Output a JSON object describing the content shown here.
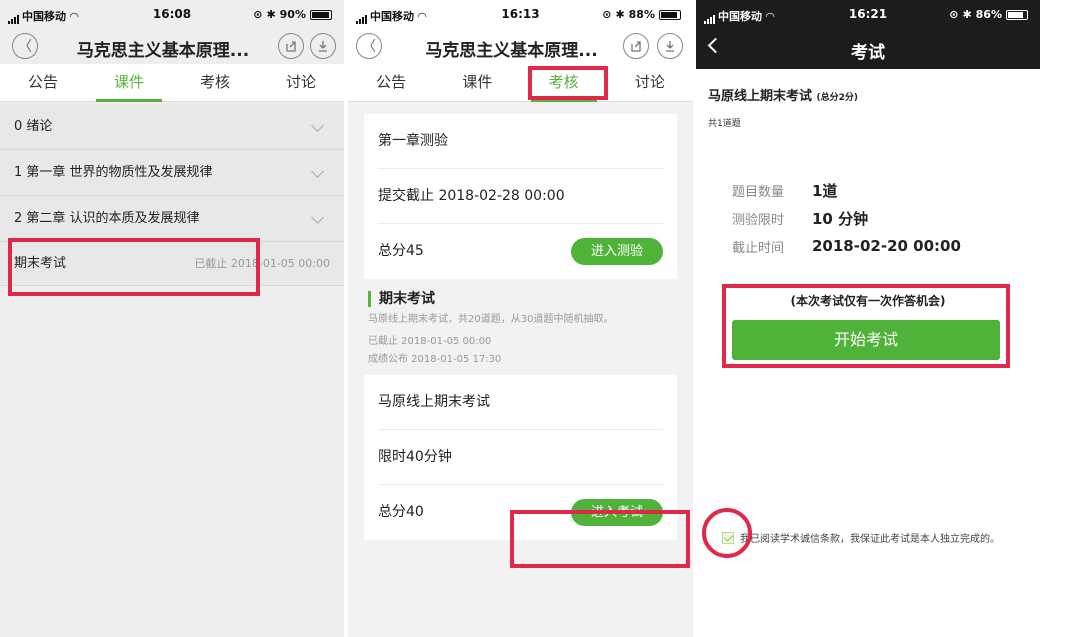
{
  "panel1": {
    "status": {
      "carrier": "中国移动",
      "time": "16:08",
      "battery": "90%"
    },
    "title": "马克思主义基本原理...",
    "tabs": [
      "公告",
      "课件",
      "考核",
      "讨论"
    ],
    "active_tab": "课件",
    "rows": [
      {
        "label": "0 绪论"
      },
      {
        "label": "1  第一章  世界的物质性及发展规律"
      },
      {
        "label": "2 第二章 认识的本质及发展规律"
      }
    ],
    "final": {
      "label": "期末考试",
      "meta": "已截止 2018-01-05 00:00"
    }
  },
  "panel2": {
    "status": {
      "carrier": "中国移动",
      "time": "16:13",
      "battery": "88%"
    },
    "title": "马克思主义基本原理...",
    "tabs": [
      "公告",
      "课件",
      "考核",
      "讨论"
    ],
    "active_tab": "考核",
    "quiz_card": {
      "name": "第一章测验",
      "deadline": "提交截止 2018-02-28 00:00",
      "score": "总分45",
      "button": "进入测验"
    },
    "final_section": {
      "heading": "期末考试",
      "desc": "马原线上期末考试，共20道题，从30道题中随机抽取。",
      "closed": "已截止 2018-01-05 00:00",
      "published": "成绩公布 2018-01-05 17:30"
    },
    "exam_card": {
      "name": "马原线上期末考试",
      "limit": "限时40分钟",
      "score": "总分40",
      "button": "进入考试"
    }
  },
  "panel3": {
    "status": {
      "carrier": "中国移动",
      "time": "16:21",
      "battery": "86%"
    },
    "title": "考试",
    "exam_title": "马原线上期末考试",
    "total_score": "(总分2分)",
    "count_text": "共1道题",
    "info": [
      {
        "key": "题目数量",
        "value": "1道"
      },
      {
        "key": "测验限时",
        "value": "10 分钟"
      },
      {
        "key": "截止时间",
        "value": "2018-02-20 00:00"
      }
    ],
    "once_notice": "(本次考试仅有一次作答机会)",
    "start_button": "开始考试",
    "agreement": "我已阅读学术诚信条款，我保证此考试是本人独立完成的。"
  }
}
